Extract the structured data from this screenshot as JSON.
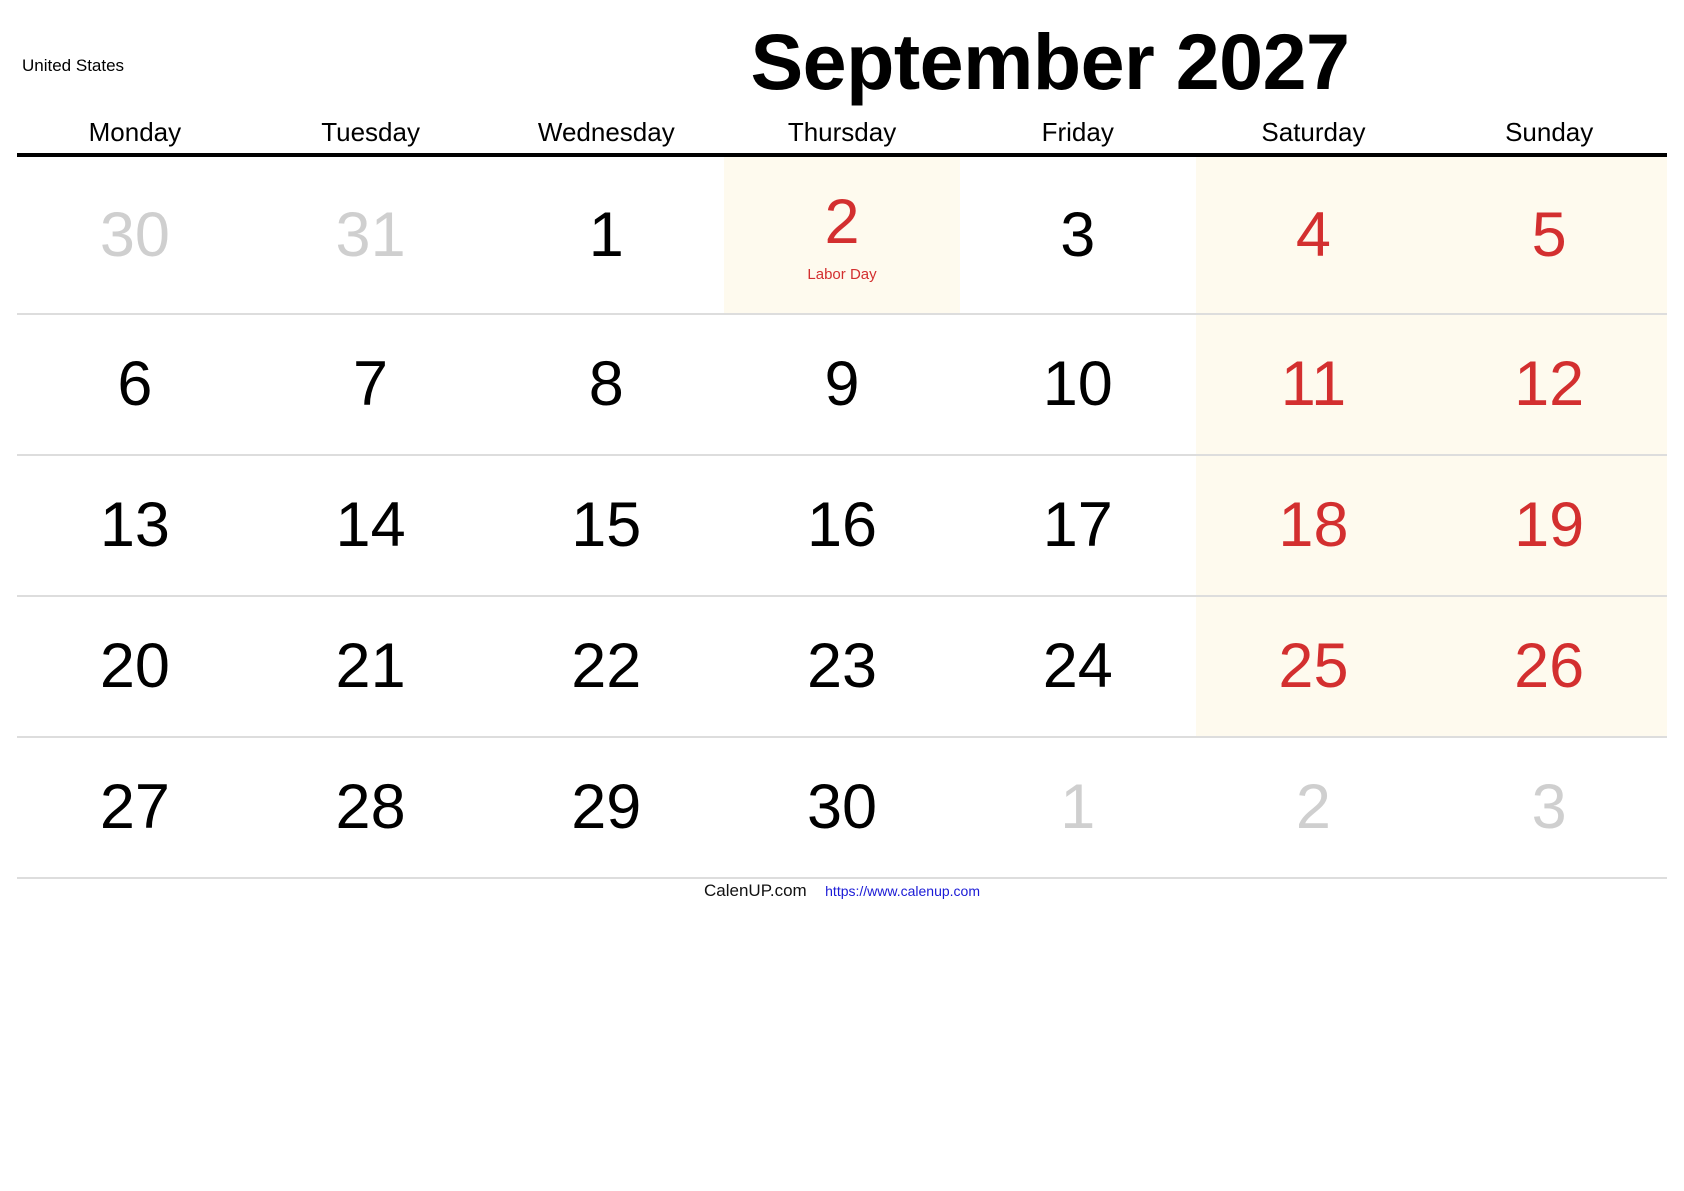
{
  "country": "United States",
  "title": "September 2027",
  "weekdays": [
    "Monday",
    "Tuesday",
    "Wednesday",
    "Thursday",
    "Friday",
    "Saturday",
    "Sunday"
  ],
  "colors": {
    "weekend_text": "#d32f2f",
    "weekend_background": "#fefaee",
    "other_month_text": "#cfcfcf",
    "link": "#1a1ad6"
  },
  "weeks": [
    [
      {
        "day": "30",
        "type": "other"
      },
      {
        "day": "31",
        "type": "other"
      },
      {
        "day": "1",
        "type": "normal"
      },
      {
        "day": "2",
        "type": "holiday",
        "holiday": "Labor Day"
      },
      {
        "day": "3",
        "type": "normal"
      },
      {
        "day": "4",
        "type": "weekend"
      },
      {
        "day": "5",
        "type": "weekend"
      }
    ],
    [
      {
        "day": "6",
        "type": "normal"
      },
      {
        "day": "7",
        "type": "normal"
      },
      {
        "day": "8",
        "type": "normal"
      },
      {
        "day": "9",
        "type": "normal"
      },
      {
        "day": "10",
        "type": "normal"
      },
      {
        "day": "11",
        "type": "weekend"
      },
      {
        "day": "12",
        "type": "weekend"
      }
    ],
    [
      {
        "day": "13",
        "type": "normal"
      },
      {
        "day": "14",
        "type": "normal"
      },
      {
        "day": "15",
        "type": "normal"
      },
      {
        "day": "16",
        "type": "normal"
      },
      {
        "day": "17",
        "type": "normal"
      },
      {
        "day": "18",
        "type": "weekend"
      },
      {
        "day": "19",
        "type": "weekend"
      }
    ],
    [
      {
        "day": "20",
        "type": "normal"
      },
      {
        "day": "21",
        "type": "normal"
      },
      {
        "day": "22",
        "type": "normal"
      },
      {
        "day": "23",
        "type": "normal"
      },
      {
        "day": "24",
        "type": "normal"
      },
      {
        "day": "25",
        "type": "weekend"
      },
      {
        "day": "26",
        "type": "weekend"
      }
    ],
    [
      {
        "day": "27",
        "type": "normal"
      },
      {
        "day": "28",
        "type": "normal"
      },
      {
        "day": "29",
        "type": "normal"
      },
      {
        "day": "30",
        "type": "normal"
      },
      {
        "day": "1",
        "type": "other"
      },
      {
        "day": "2",
        "type": "other"
      },
      {
        "day": "3",
        "type": "other"
      }
    ]
  ],
  "footer": {
    "brand": "CalenUP.com",
    "link": "https://www.calenup.com"
  }
}
